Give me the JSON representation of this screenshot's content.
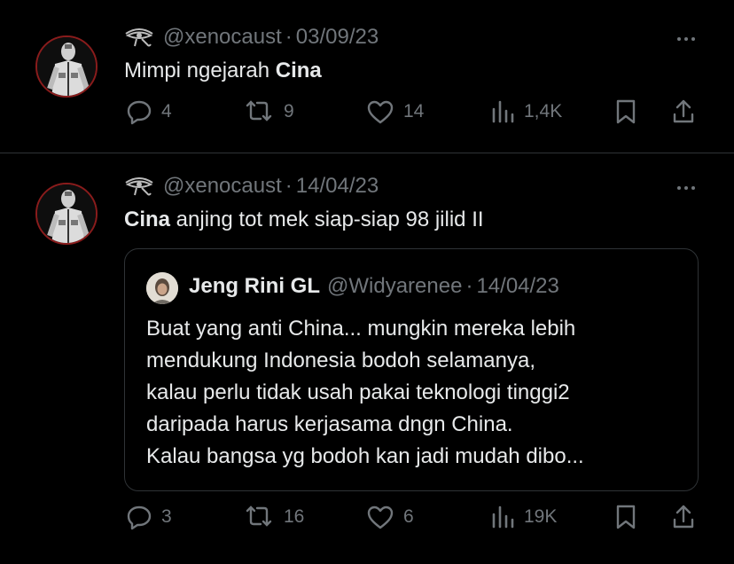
{
  "tweets": [
    {
      "handle": "@xenocaust",
      "sep": "·",
      "date": "03/09/23",
      "text_plain": "Mimpi ngejarah ",
      "text_bold": "Cina",
      "replies": "4",
      "reposts": "9",
      "likes": "14",
      "views": "1,4K"
    },
    {
      "handle": "@xenocaust",
      "sep": "·",
      "date": "14/04/23",
      "text_bold": "Cina",
      "text_plain": " anjing tot mek siap-siap 98 jilid II",
      "quote": {
        "name": "Jeng Rini GL",
        "handle": "@Widyarenee",
        "sep": "·",
        "date": "14/04/23",
        "lines": [
          "Buat yang anti China... mungkin mereka lebih",
          "mendukung Indonesia bodoh selamanya,",
          "kalau perlu tidak usah pakai teknologi tinggi2",
          "daripada harus kerjasama dngn China.",
          "Kalau bangsa yg bodoh kan jadi mudah dibo..."
        ]
      },
      "replies": "3",
      "reposts": "16",
      "likes": "6",
      "views": "19K"
    }
  ],
  "colors": {
    "background": "#000000",
    "text": "#e7e9ea",
    "secondary": "#71767b",
    "border": "#2f3336"
  },
  "icons": [
    "eye-of-horus-icon",
    "more-icon",
    "reply-icon",
    "repost-icon",
    "like-icon",
    "views-icon",
    "bookmark-icon",
    "share-icon"
  ]
}
